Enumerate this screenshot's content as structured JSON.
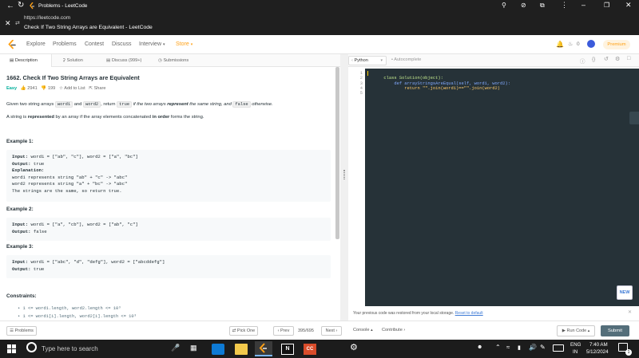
{
  "browser": {
    "tab_title": "Problems - LeetCode",
    "url": "https://leetcode.com",
    "page_title": "Check If Two String Arrays are Equivalent - LeetCode"
  },
  "nav": {
    "items": [
      "Explore",
      "Problems",
      "Contest",
      "Discuss",
      "Interview",
      "Store"
    ],
    "notif_count": "0",
    "premium": "Premium"
  },
  "left_tabs": [
    "Description",
    "Solution",
    "Discuss (999+)",
    "Submissions"
  ],
  "problem": {
    "title": "1662. Check If Two String Arrays are Equivalent",
    "difficulty": "Easy",
    "likes": "2941",
    "dislikes": "199",
    "add_to_list": "Add to List",
    "share": "Share",
    "desc1_a": "Given two string arrays ",
    "desc1_code1": "word1",
    "desc1_b": " and ",
    "desc1_code2": "word2",
    "desc1_c": ", return ",
    "desc1_code3": "true",
    "desc1_d": " if the two arrays ",
    "desc1_e": "represent",
    "desc1_f": " the same string, and ",
    "desc1_code4": "false",
    "desc1_g": " otherwise.",
    "desc2_a": "A string is ",
    "desc2_b": "represented",
    "desc2_c": " by an array if the array elements concatenated ",
    "desc2_d": "in order",
    "desc2_e": " forms the string.",
    "examples": [
      {
        "heading": "Example 1:",
        "input_label": "Input:",
        "input": " word1 = [\"ab\", \"c\"], word2 = [\"a\", \"bc\"]",
        "output_label": "Output:",
        "output": " true",
        "explanation_label": "Explanation:",
        "explanation": [
          "word1 represents string \"ab\" + \"c\" -> \"abc\"",
          "word2 represents string \"a\" + \"bc\" -> \"abc\"",
          "The strings are the same, so return true."
        ]
      },
      {
        "heading": "Example 2:",
        "input_label": "Input:",
        "input": " word1 = [\"a\", \"cb\"], word2 = [\"ab\", \"c\"]",
        "output_label": "Output:",
        "output": " false"
      },
      {
        "heading": "Example 3:",
        "input_label": "Input:",
        "input": " word1  = [\"abc\", \"d\", \"defg\"], word2 = [\"abcddefg\"]",
        "output_label": "Output:",
        "output": " true"
      }
    ],
    "constraints_heading": "Constraints:",
    "constraints": [
      "1 <= word1.length, word2.length <= 10³",
      "1 <= word1[i].length, word2[i].length <= 10³"
    ]
  },
  "editor": {
    "language": "Python",
    "autocomplete": "Autocomplete",
    "line_numbers": [
      "1",
      "2",
      "3",
      "4",
      "5"
    ],
    "lines": [
      "class Solution(object):",
      "    def arrayStringsAreEqual(self, word1, word2):",
      "        return \"\".join(word1)==\"\".join(word2)"
    ],
    "new_badge": "NEW",
    "restore_msg": "Your previous code was restored from your local storage.",
    "reset_link": "Reset to default"
  },
  "bottom": {
    "problems": "Problems",
    "pick_one": "Pick One",
    "prev": "Prev",
    "page": "395/695",
    "next": "Next",
    "console": "Console",
    "contribute": "Contribute",
    "run_code": "Run Code",
    "submit": "Submit"
  },
  "taskbar": {
    "search_placeholder": "Type here to search",
    "lang": "ENG",
    "region": "IN",
    "time": "7:40 AM",
    "date": "5/12/2024",
    "notif": "1"
  },
  "colors": {
    "brand": "#ffa116",
    "easy": "#00af9b",
    "editor_bg": "#263238",
    "submit_bg": "#546e7a"
  }
}
